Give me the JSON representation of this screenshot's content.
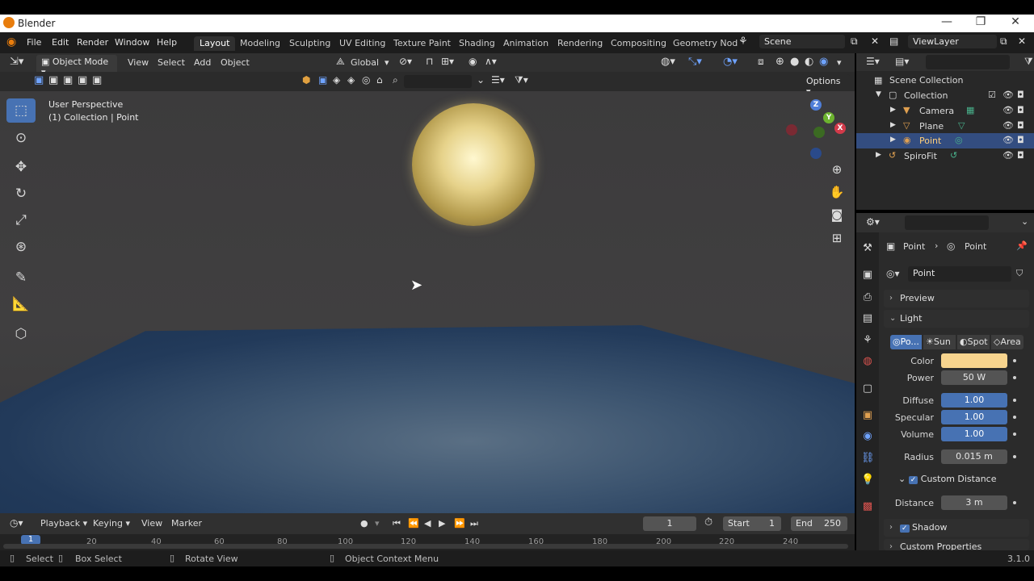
{
  "window": {
    "title": "Blender",
    "minimize": "—",
    "maximize": "❐",
    "close": "✕"
  },
  "topbar": {
    "menus": [
      "File",
      "Edit",
      "Render",
      "Window",
      "Help"
    ],
    "workspaces": [
      "Layout",
      "Modeling",
      "Sculpting",
      "UV Editing",
      "Texture Paint",
      "Shading",
      "Animation",
      "Rendering",
      "Compositing",
      "Geometry Nod"
    ],
    "active_workspace": "Layout",
    "scene": "Scene",
    "view_layer": "ViewLayer"
  },
  "viewport_header": {
    "mode": "Object Mode",
    "menus": [
      "View",
      "Select",
      "Add",
      "Object"
    ],
    "orientation": "Global",
    "options": "Options"
  },
  "viewport": {
    "perspective": "User Perspective",
    "context": "(1) Collection | Point",
    "gizmo": {
      "z": "Z",
      "y": "Y",
      "x": "X"
    }
  },
  "outliner": {
    "rows": [
      {
        "label": "Scene Collection",
        "icon": "scene-collection-icon"
      },
      {
        "label": "Collection",
        "icon": "collection-icon"
      },
      {
        "label": "Camera",
        "icon": "camera-icon"
      },
      {
        "label": "Plane",
        "icon": "mesh-icon"
      },
      {
        "label": "Point",
        "icon": "light-icon",
        "selected": true
      },
      {
        "label": "SpiroFit",
        "icon": "curve-icon"
      }
    ]
  },
  "properties": {
    "breadcrumb": [
      "Point",
      "Point"
    ],
    "datablock": "Point",
    "sections": {
      "preview": "Preview",
      "light": "Light",
      "shadow": "Shadow",
      "custom_properties": "Custom Properties"
    },
    "light_types": [
      "Po...",
      "Sun",
      "Spot",
      "Area"
    ],
    "color_label": "Color",
    "color_value": "#f7d48e",
    "power_label": "Power",
    "power": "50 W",
    "diffuse_label": "Diffuse",
    "diffuse": "1.00",
    "specular_label": "Specular",
    "specular": "1.00",
    "volume_label": "Volume",
    "volume": "1.00",
    "radius_label": "Radius",
    "radius": "0.015 m",
    "custom_distance": "Custom Distance",
    "distance_label": "Distance",
    "distance": "3 m"
  },
  "timeline": {
    "menus": [
      "Playback",
      "Keying",
      "View",
      "Marker"
    ],
    "current_frame": "1",
    "start_label": "Start",
    "start": "1",
    "end_label": "End",
    "end": "250",
    "ticks": [
      "1",
      "20",
      "40",
      "60",
      "80",
      "100",
      "120",
      "140",
      "160",
      "180",
      "200",
      "220",
      "240"
    ]
  },
  "statusbar": {
    "select": "Select",
    "box_select": "Box Select",
    "rotate_view": "Rotate View",
    "context_menu": "Object Context Menu",
    "version": "3.1.0"
  },
  "colors": {
    "accent": "#4772b3",
    "selected_row": "#334d80",
    "light_color": "#f7d48e"
  }
}
